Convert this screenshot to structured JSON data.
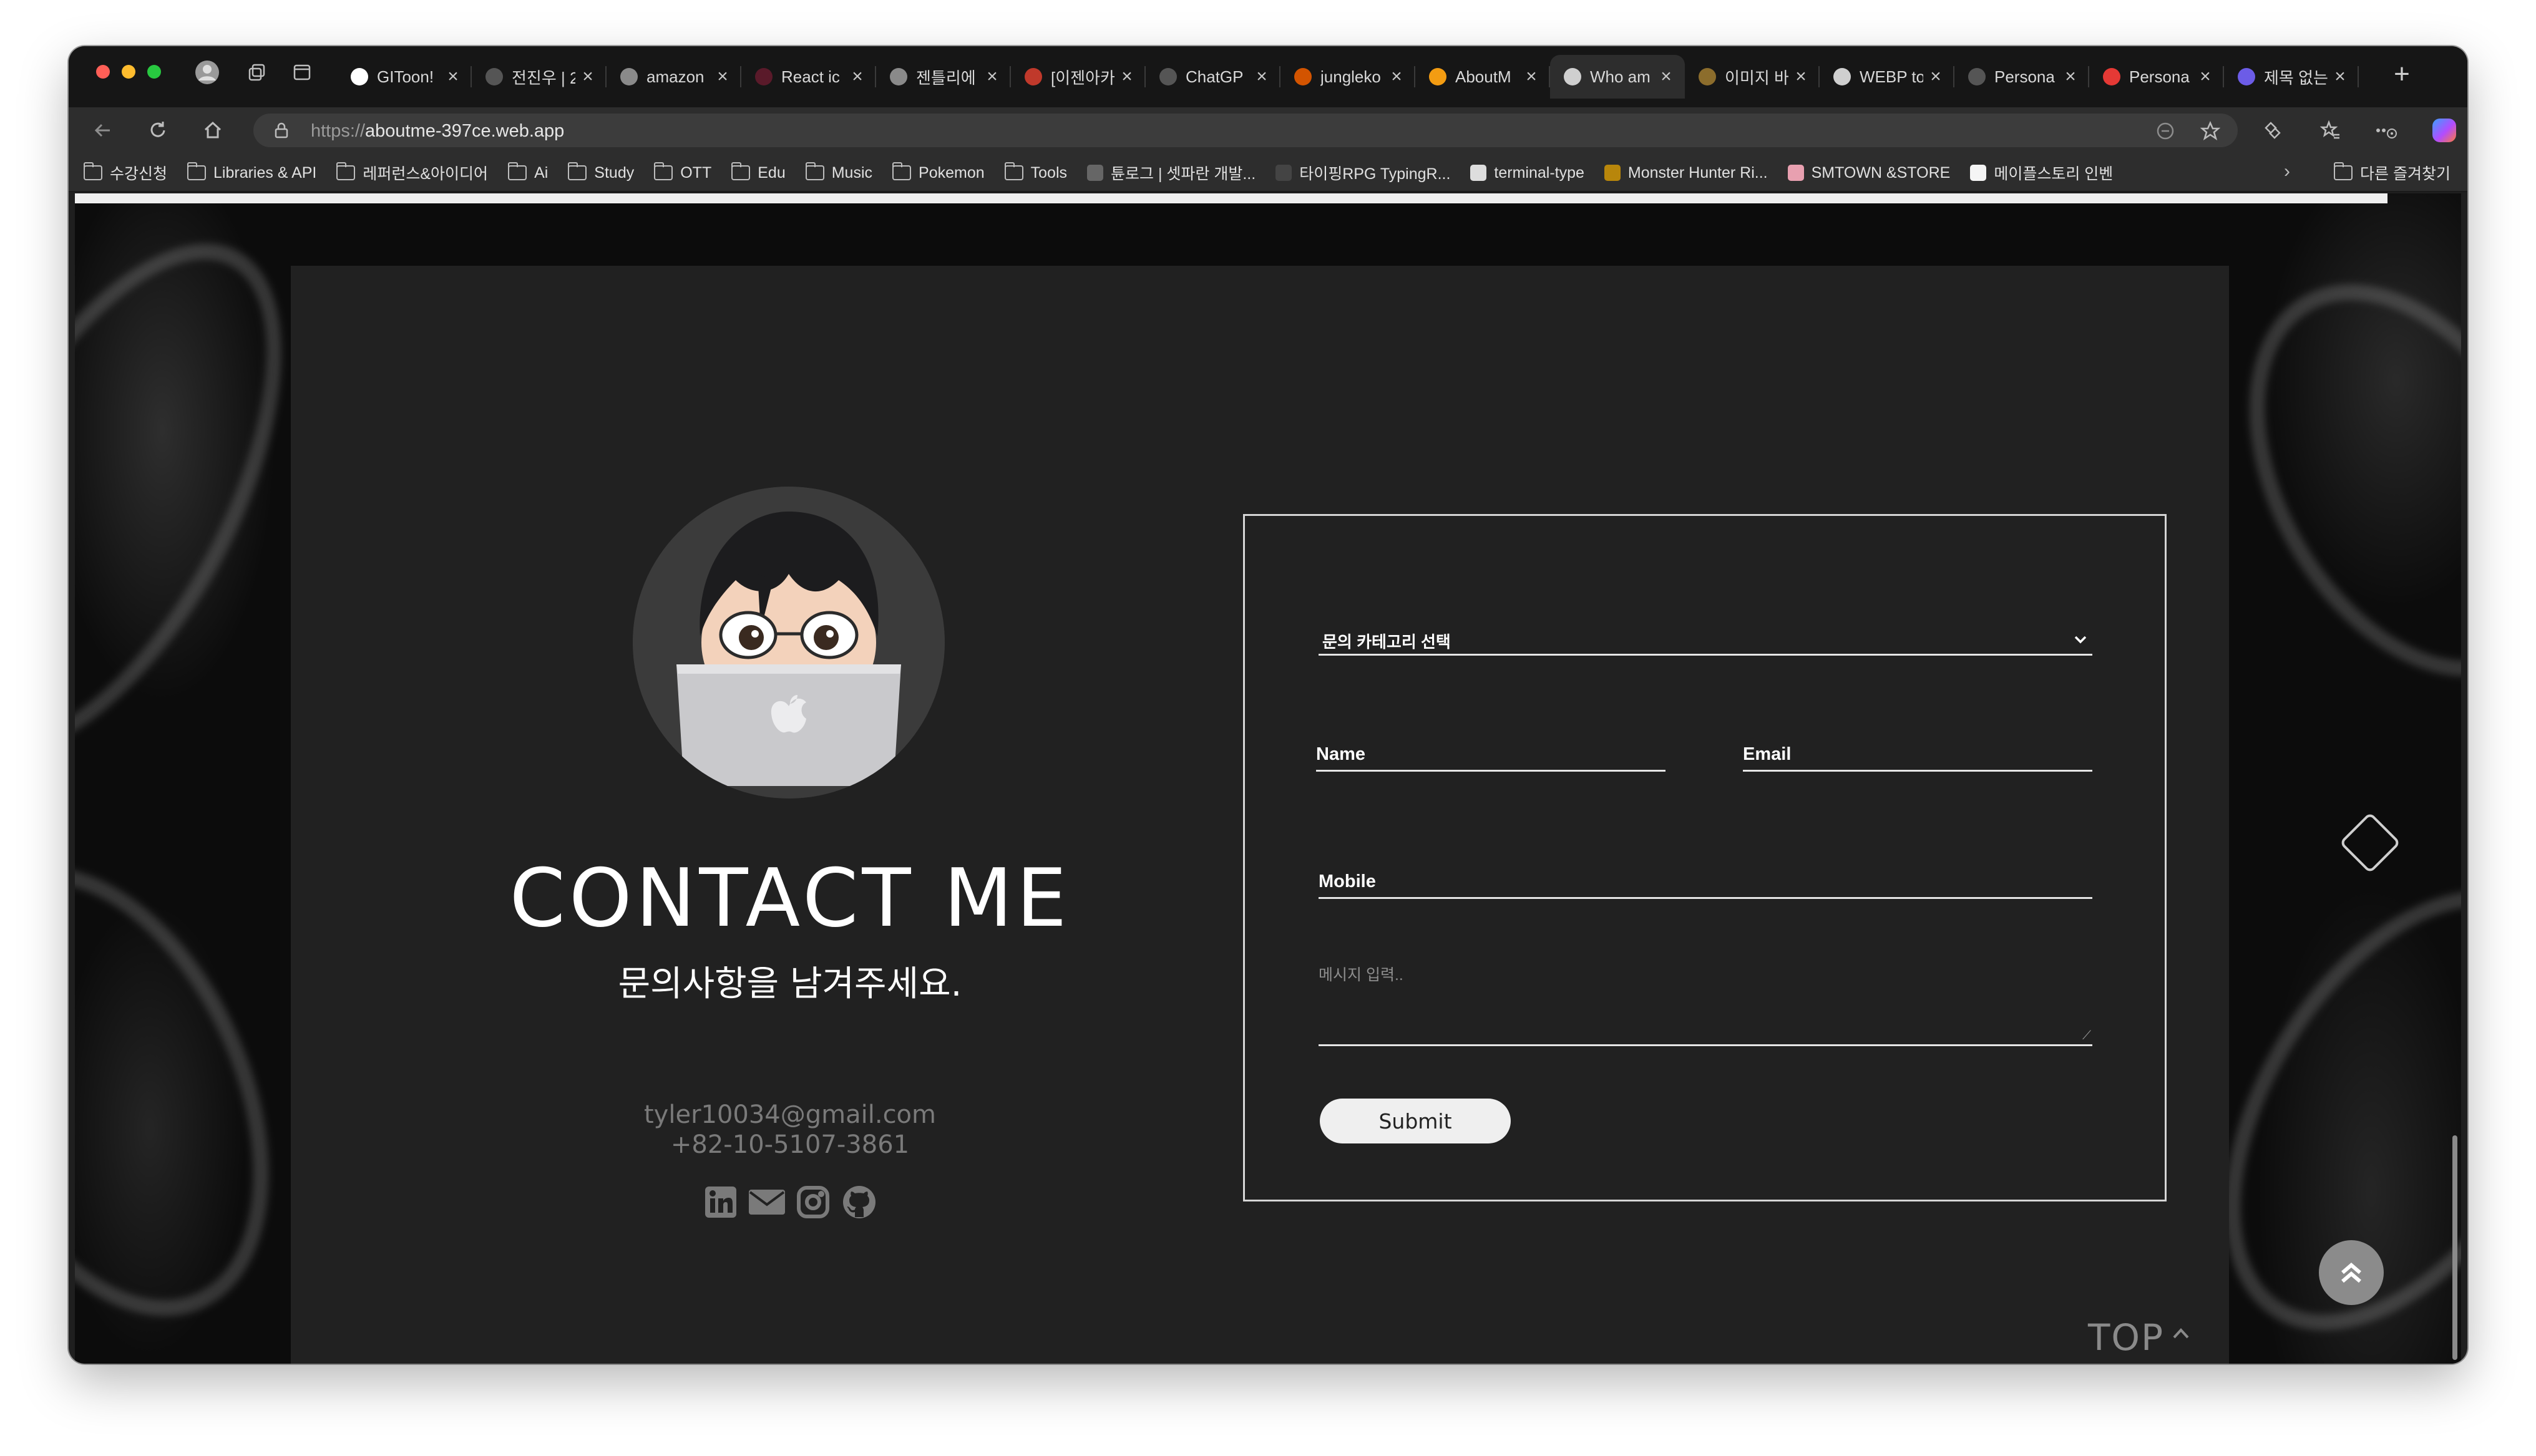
{
  "browser": {
    "tabs": [
      {
        "label": "GIToon!",
        "icon": "github-icon",
        "color": "#ffffff"
      },
      {
        "label": "전진우 | 2",
        "icon": "site-icon",
        "color": "#555555"
      },
      {
        "label": "amazon",
        "icon": "chrome-icon",
        "color": "#8a8a8a"
      },
      {
        "label": "React ic",
        "icon": "react-icon",
        "color": "#5a1a2a"
      },
      {
        "label": "젠틀리에",
        "icon": "chrome-icon",
        "color": "#8a8a8a"
      },
      {
        "label": "[이젠아카",
        "icon": "gmail-icon",
        "color": "#c0392b"
      },
      {
        "label": "ChatGP",
        "icon": "chatgpt-icon",
        "color": "#555555"
      },
      {
        "label": "jungleko",
        "icon": "fire-icon",
        "color": "#d35400"
      },
      {
        "label": "AboutM",
        "icon": "firebase-icon",
        "color": "#f39c12"
      },
      {
        "label": "Who am",
        "icon": "share-icon",
        "color": "#cfcfcf"
      },
      {
        "label": "이미지 바",
        "icon": "image-icon",
        "color": "#8c6d2c"
      },
      {
        "label": "WEBP to",
        "icon": "cloud-icon",
        "color": "#cfcfcf"
      },
      {
        "label": "Persona",
        "icon": "arrow-icon",
        "color": "#555555"
      },
      {
        "label": "Persona",
        "icon": "youtube-icon",
        "color": "#e53935"
      },
      {
        "label": "제목 없는",
        "icon": "doc-icon",
        "color": "#6c5ce7"
      }
    ],
    "active_tab_index": 9,
    "url_scheme": "https://",
    "url_host": "aboutme-397ce.web.app",
    "bookmarks": [
      {
        "label": "수강신청",
        "type": "folder"
      },
      {
        "label": "Libraries & API",
        "type": "folder"
      },
      {
        "label": "레퍼런스&아이디어",
        "type": "folder"
      },
      {
        "label": "Ai",
        "type": "folder"
      },
      {
        "label": "Study",
        "type": "folder"
      },
      {
        "label": "OTT",
        "type": "folder"
      },
      {
        "label": "Edu",
        "type": "folder"
      },
      {
        "label": "Music",
        "type": "folder"
      },
      {
        "label": "Pokemon",
        "type": "folder"
      },
      {
        "label": "Tools",
        "type": "folder"
      },
      {
        "label": "튠로그 | 셋파란 개발...",
        "type": "site",
        "color": "#666666"
      },
      {
        "label": "타이핑RPG TypingR...",
        "type": "site",
        "color": "#444444"
      },
      {
        "label": "terminal-type",
        "type": "site",
        "color": "#dddddd"
      },
      {
        "label": "Monster Hunter Ri...",
        "type": "site",
        "color": "#b8860b"
      },
      {
        "label": "SMTOWN &STORE",
        "type": "site",
        "color": "#e8a0b0"
      },
      {
        "label": "메이플스토리 인벤",
        "type": "site",
        "color": "#f5f5f5"
      }
    ],
    "other_bookmarks": "다른 즐겨찾기"
  },
  "page": {
    "title": "CONTACT ME",
    "subtitle": "문의사항을 남겨주세요.",
    "email": "tyler10034@gmail.com",
    "phone": "+82-10-5107-3861",
    "socials": [
      "linkedin-icon",
      "mail-icon",
      "instagram-icon",
      "github-icon"
    ],
    "form": {
      "category_placeholder": "문의 카테고리 선택",
      "name_label": "Name",
      "email_label": "Email",
      "mobile_label": "Mobile",
      "message_placeholder": "메시지 입력..",
      "submit_label": "Submit"
    },
    "top_link": "TOP"
  }
}
